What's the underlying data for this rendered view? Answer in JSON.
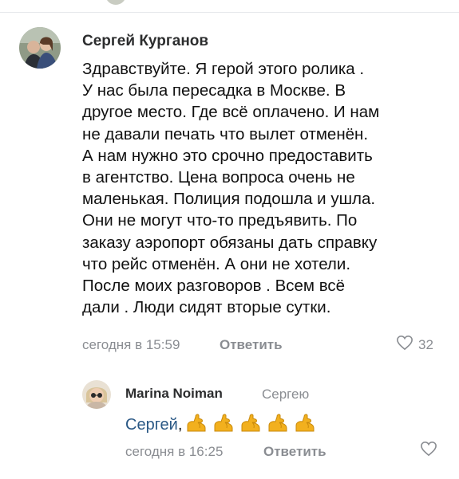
{
  "comments": [
    {
      "author": "Сергей Курганов",
      "text": "Здравствуйте. Я герой этого ролика .\nУ нас была пересадка в Москве. В\nдругое место. Где всё оплачено. И нам\nне давали печать что вылет отменён.\nА нам нужно это срочно предоставить\nв агентство. Цена вопроса очень не\nмаленькая. Полиция подошла и ушла.\nОни не могут что-то предъявить. По\nзаказу аэропорт обязаны дать справку\nчто рейс отменён. А они не хотели.\nПосле моих разговоров . Всем всё\nдали . Люди сидят вторые сутки.",
      "time": "сегодня в 15:59",
      "reply_label": "Ответить",
      "likes": "32"
    },
    {
      "author": "Marina Noiman",
      "reply_to": "Сергею",
      "mention": "Сергей",
      "text_suffix": ",",
      "emoji_icon": "flexed-biceps",
      "emoji_count": 5,
      "time": "сегодня в 16:25",
      "reply_label": "Ответить"
    }
  ],
  "colors": {
    "link": "#2a5885",
    "meta": "#8a8d92",
    "emoji": "#f2b01e"
  }
}
